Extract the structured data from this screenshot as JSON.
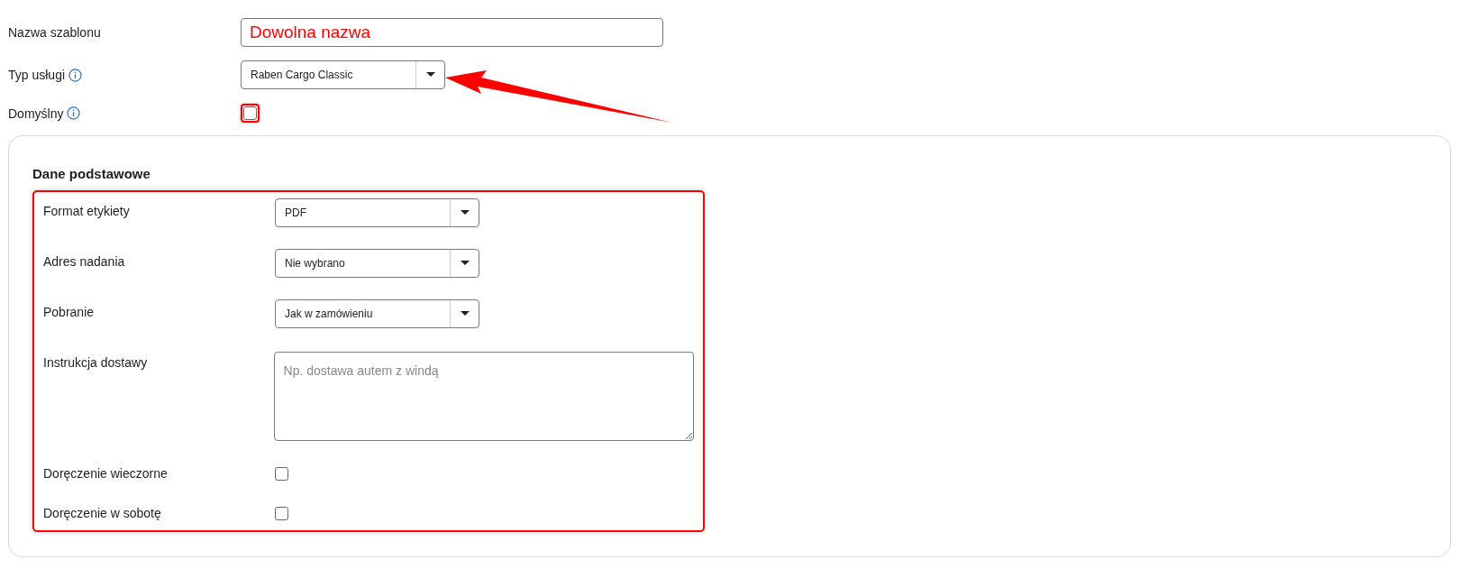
{
  "top_fields": [
    {
      "kind": "text",
      "label": "Nazwa szablonu",
      "value": "Dowolna nazwa",
      "info": false,
      "highlighted": true
    },
    {
      "kind": "select",
      "label": "Typ usługi",
      "value": "Raben Cargo Classic",
      "info": true,
      "highlighted": false,
      "arrow": true
    },
    {
      "kind": "checkbox",
      "label": "Domyślny",
      "checked": false,
      "info": true,
      "highlighted": true
    }
  ],
  "section": {
    "title": "Dane podstawowe",
    "highlighted": true,
    "fields": [
      {
        "kind": "select",
        "label": "Format etykiety",
        "value": "PDF"
      },
      {
        "kind": "select",
        "label": "Adres nadania",
        "value": "Nie wybrano"
      },
      {
        "kind": "select",
        "label": "Pobranie",
        "value": "Jak w zamówieniu"
      },
      {
        "kind": "textarea",
        "label": "Instrukcja dostawy",
        "placeholder": "Np. dostawa autem z windą"
      },
      {
        "kind": "checkbox",
        "label": "Doręczenie wieczorne",
        "checked": false
      },
      {
        "kind": "checkbox",
        "label": "Doręczenie w sobotę",
        "checked": false
      }
    ]
  }
}
